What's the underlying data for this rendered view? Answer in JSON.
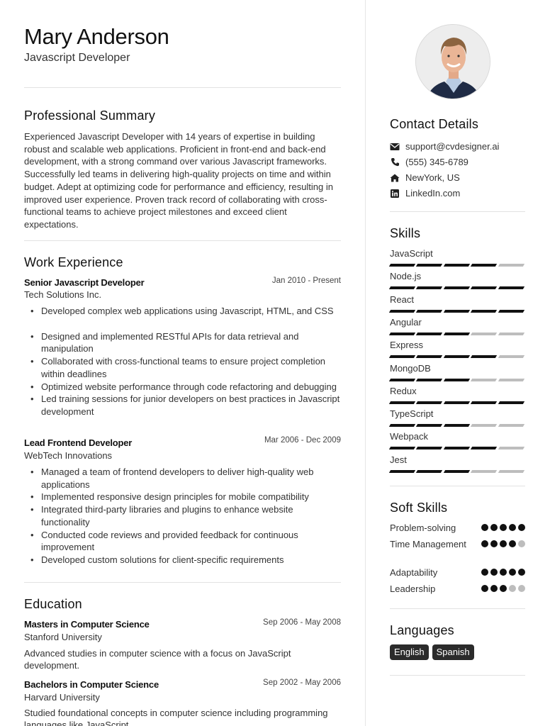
{
  "header": {
    "name": "Mary Anderson",
    "title": "Javascript Developer"
  },
  "summary": {
    "heading": "Professional Summary",
    "text": "Experienced Javascript Developer with 14 years of expertise in building robust and scalable web applications. Proficient in front-end and back-end development, with a strong command over various Javascript frameworks. Successfully led teams in delivering high-quality projects on time and within budget. Adept at optimizing code for performance and efficiency, resulting in improved user experience. Proven track record of collaborating with cross-functional teams to achieve project milestones and exceed client expectations."
  },
  "work": {
    "heading": "Work Experience",
    "jobs": [
      {
        "title": "Senior Javascript Developer",
        "date": "Jan 2010 - Present",
        "company": "Tech Solutions Inc.",
        "bullets": [
          "Developed complex web applications using Javascript, HTML, and CSS",
          "Designed and implemented RESTful APIs for data retrieval and manipulation",
          "Collaborated with cross-functional teams to ensure project completion within deadlines",
          "Optimized website performance through code refactoring and debugging",
          "Led training sessions for junior developers on best practices in Javascript development"
        ]
      },
      {
        "title": "Lead Frontend Developer",
        "date": "Mar 2006 - Dec 2009",
        "company": "WebTech Innovations",
        "bullets": [
          "Managed a team of frontend developers to deliver high-quality web applications",
          "Implemented responsive design principles for mobile compatibility",
          "Integrated third-party libraries and plugins to enhance website functionality",
          "Conducted code reviews and provided feedback for continuous improvement",
          "Developed custom solutions for client-specific requirements"
        ]
      }
    ]
  },
  "education": {
    "heading": "Education",
    "items": [
      {
        "degree": "Masters in Computer Science",
        "date": "Sep 2006 - May 2008",
        "school": "Stanford University",
        "description": "Advanced studies in computer science with a focus on JavaScript development."
      },
      {
        "degree": "Bachelors in Computer Science",
        "date": "Sep 2002 - May 2006",
        "school": "Harvard University",
        "description": "Studied foundational concepts in computer science including programming languages like JavaScript."
      }
    ]
  },
  "sidebar": {
    "photo_alt": "Profile photo",
    "contact": {
      "heading": "Contact Details",
      "items": [
        {
          "icon": "envelope-icon",
          "text": "support@cvdesigner.ai"
        },
        {
          "icon": "phone-icon",
          "text": "(555) 345-6789"
        },
        {
          "icon": "home-icon",
          "text": "NewYork, US"
        },
        {
          "icon": "linkedin-icon",
          "text": "LinkedIn.com"
        }
      ]
    },
    "skills": {
      "heading": "Skills",
      "max": 5,
      "items": [
        {
          "name": "JavaScript",
          "level": 4
        },
        {
          "name": "Node.js",
          "level": 5
        },
        {
          "name": "React",
          "level": 5
        },
        {
          "name": "Angular",
          "level": 3
        },
        {
          "name": "Express",
          "level": 4
        },
        {
          "name": "MongoDB",
          "level": 3
        },
        {
          "name": "Redux",
          "level": 5
        },
        {
          "name": "TypeScript",
          "level": 3
        },
        {
          "name": "Webpack",
          "level": 4
        },
        {
          "name": "Jest",
          "level": 3
        }
      ]
    },
    "soft_skills": {
      "heading": "Soft Skills",
      "max": 5,
      "items": [
        {
          "name": "Problem-solving",
          "level": 5
        },
        {
          "name": "Time Management",
          "level": 4
        },
        {
          "name": "Adaptability",
          "level": 5
        },
        {
          "name": "Leadership",
          "level": 3
        }
      ]
    },
    "languages": {
      "heading": "Languages",
      "items": [
        "English",
        "Spanish"
      ]
    }
  }
}
